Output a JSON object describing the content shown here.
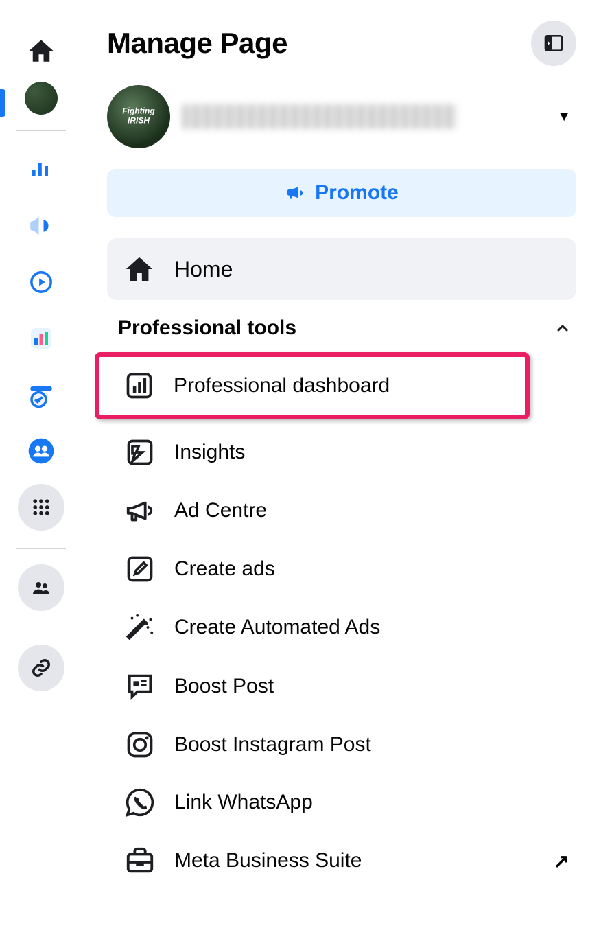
{
  "page_title": "Manage Page",
  "page_name": "[redacted page name]",
  "promote_button_label": "Promote",
  "home_nav_label": "Home",
  "section_header": "Professional tools",
  "tools": [
    {
      "id": "professional-dashboard",
      "label": "Professional dashboard",
      "highlighted": true
    },
    {
      "id": "insights",
      "label": "Insights"
    },
    {
      "id": "ad-centre",
      "label": "Ad Centre"
    },
    {
      "id": "create-ads",
      "label": "Create ads"
    },
    {
      "id": "create-automated-ads",
      "label": "Create Automated Ads"
    },
    {
      "id": "boost-post",
      "label": "Boost Post"
    },
    {
      "id": "boost-instagram-post",
      "label": "Boost Instagram Post"
    },
    {
      "id": "link-whatsapp",
      "label": "Link WhatsApp"
    },
    {
      "id": "meta-business-suite",
      "label": "Meta Business Suite",
      "external": true
    }
  ],
  "colors": {
    "accent_blue": "#1877f2",
    "light_blue": "#e7f3ff",
    "highlight": "#e91e63",
    "gray_bg": "#f0f2f5",
    "icon_bg": "#e4e6eb"
  }
}
